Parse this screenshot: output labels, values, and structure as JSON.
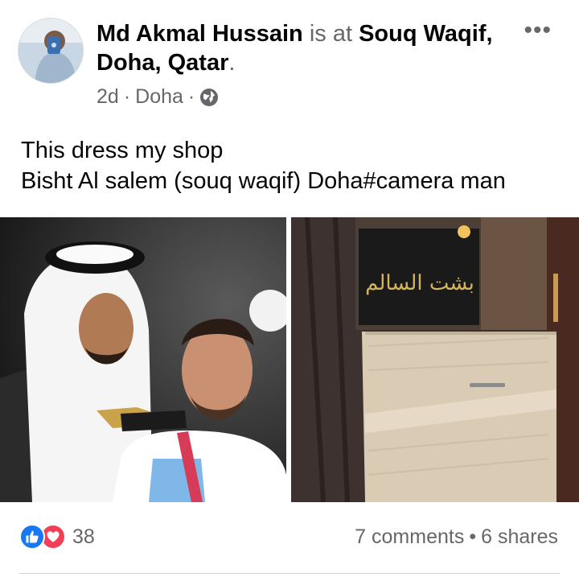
{
  "post": {
    "author": "Md Akmal Hussain",
    "is_at": "is at",
    "place": "Souq Waqif, Doha, Qatar",
    "period": ".",
    "time": "2d",
    "sep1": "·",
    "location": "Doha",
    "sep2": "·",
    "privacy_icon": "globe-icon",
    "more_label": "•••",
    "caption_line1": "This dress my shop",
    "caption_line2": "Bisht Al salem (souq waqif) Doha#camera man",
    "shop_sign": "بشت السالم"
  },
  "engagement": {
    "reaction_icons": [
      "like-icon",
      "love-icon"
    ],
    "reaction_count": "38",
    "comments": "7 comments",
    "dot": "•",
    "shares": "6 shares"
  },
  "colors": {
    "like": "#1877f2",
    "love": "#f33e58",
    "muted_text": "#65676b",
    "text": "#050505"
  }
}
